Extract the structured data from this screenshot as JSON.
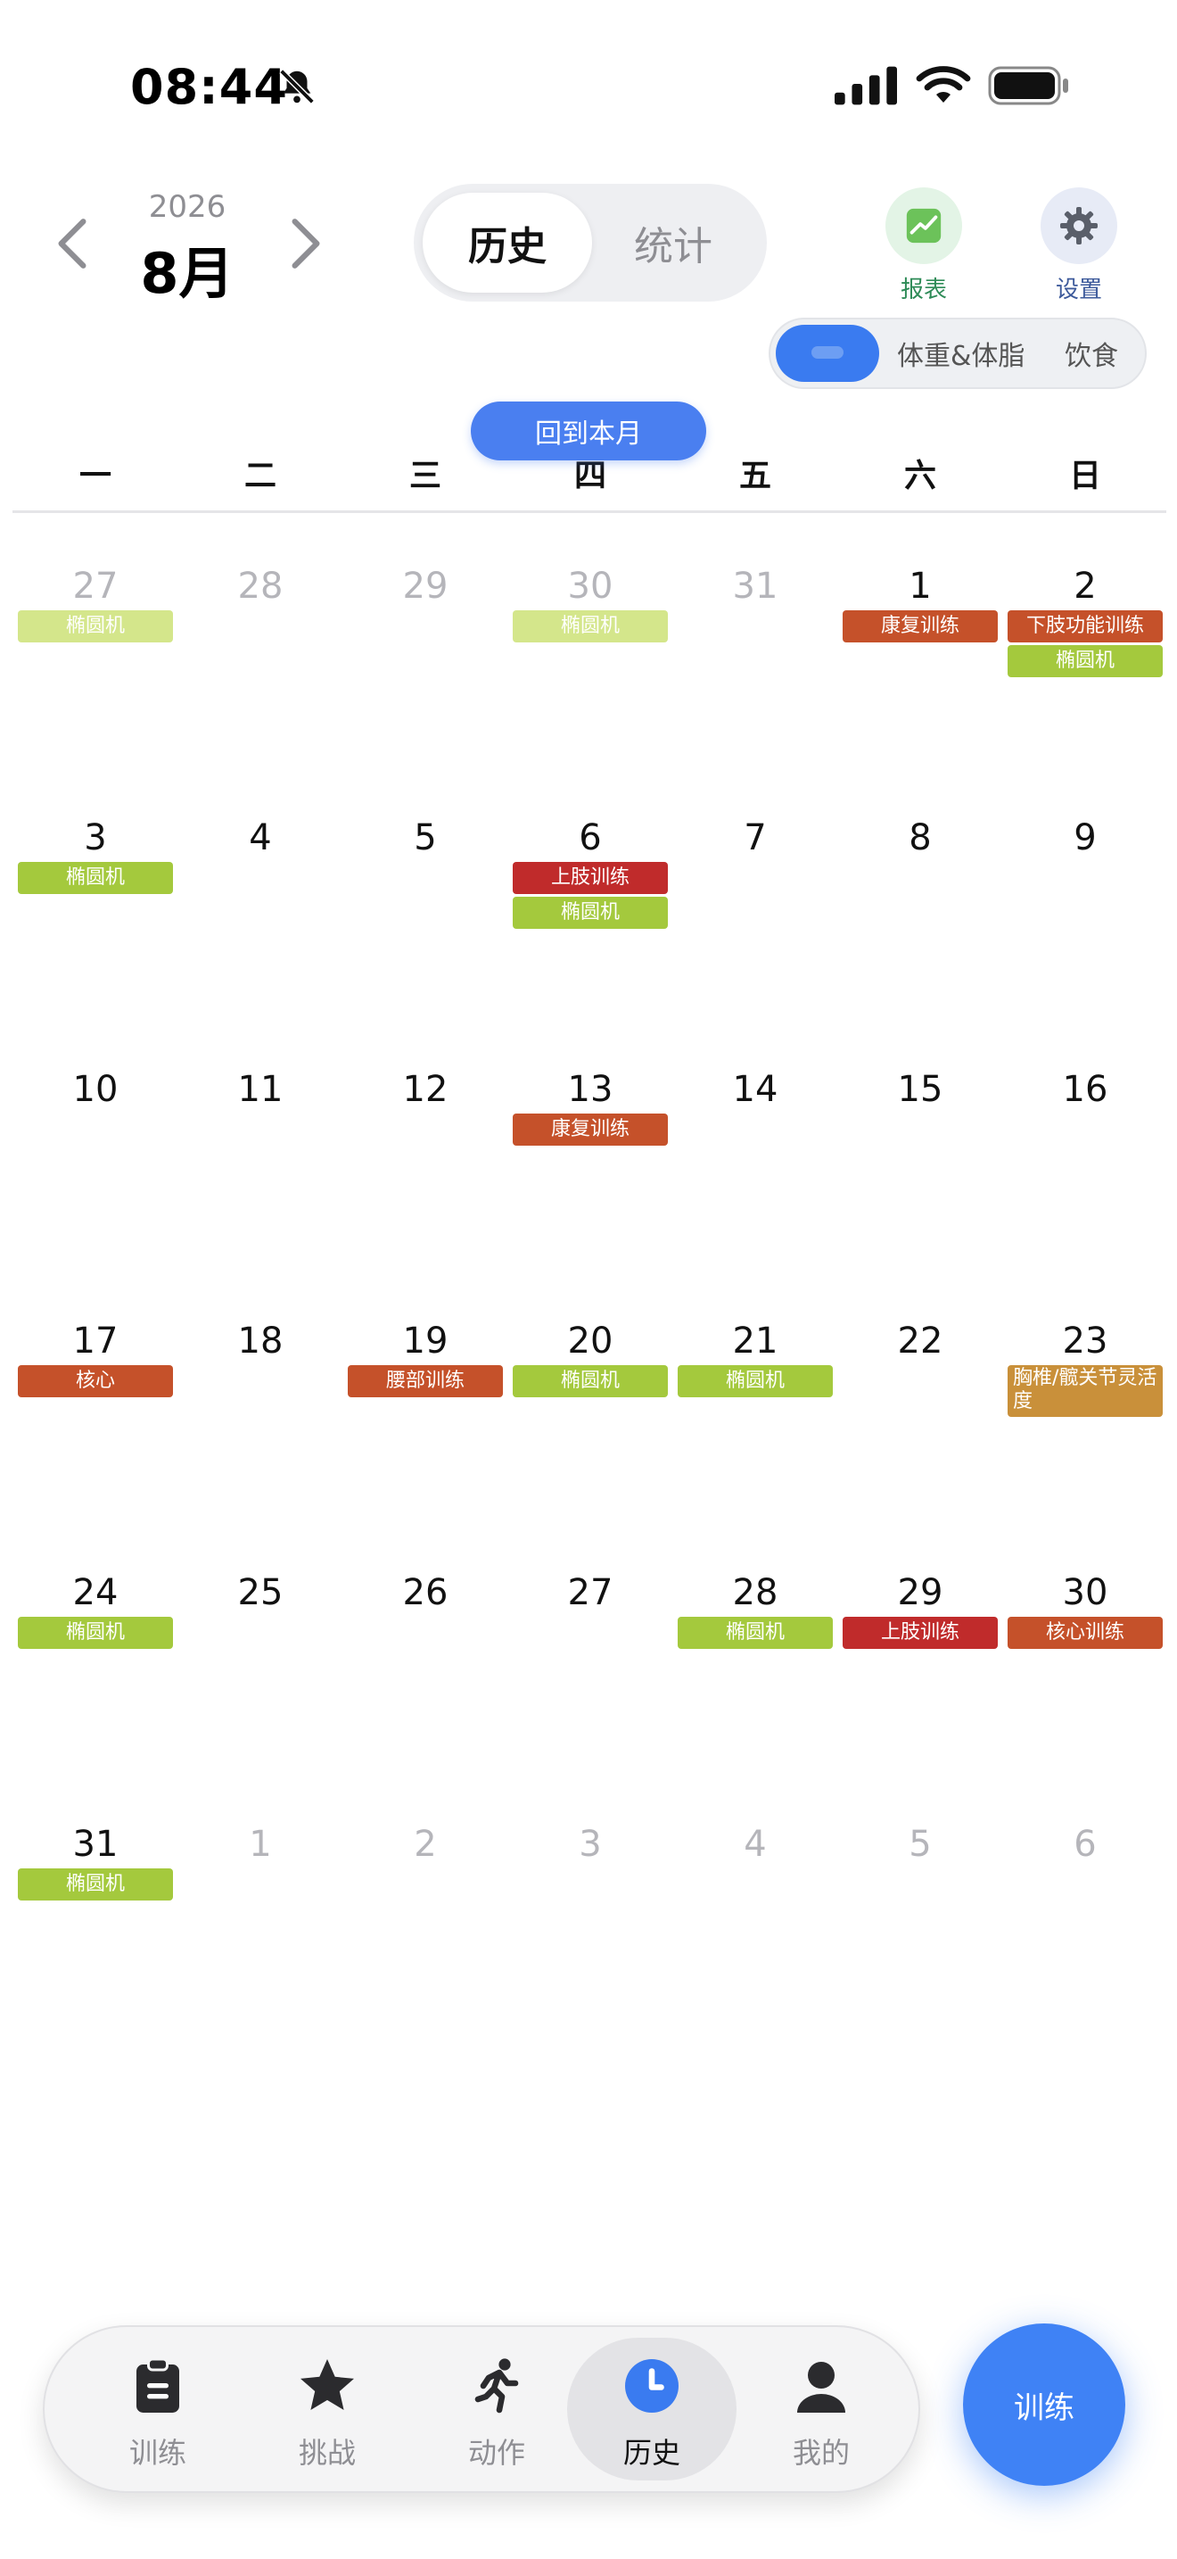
{
  "status_bar": {
    "time": "08:44",
    "icons": [
      "bell-slash-icon",
      "signal-icon",
      "wifi-icon",
      "battery-icon"
    ]
  },
  "header": {
    "year": "2026",
    "month": "8月",
    "segments": [
      "历史",
      "统计"
    ],
    "active_segment": "历史",
    "tools": [
      {
        "label": "报表",
        "icon": "chart-icon"
      },
      {
        "label": "设置",
        "icon": "gear-icon"
      }
    ],
    "filters": [
      "体重&体脂",
      "饮食"
    ],
    "back_to_month": "回到本月"
  },
  "colors": {
    "accent": "#3a7bf0",
    "tag_green": "#a4c93d",
    "tag_green_light": "#d4e68b",
    "tag_orange": "#c5512a",
    "tag_red": "#c02b2b",
    "tag_ochre": "#c9903a"
  },
  "weekdays": [
    "一",
    "二",
    "三",
    "四",
    "五",
    "六",
    "日"
  ],
  "weeks": [
    [
      {
        "day": "27",
        "muted": true,
        "tags": [
          {
            "text": "椭圆机",
            "color": "#d4e68b"
          }
        ]
      },
      {
        "day": "28",
        "muted": true,
        "tags": []
      },
      {
        "day": "29",
        "muted": true,
        "tags": []
      },
      {
        "day": "30",
        "muted": true,
        "tags": [
          {
            "text": "椭圆机",
            "color": "#d4e68b"
          }
        ]
      },
      {
        "day": "31",
        "muted": true,
        "tags": []
      },
      {
        "day": "1",
        "muted": false,
        "tags": [
          {
            "text": "康复训练",
            "color": "#c5512a"
          }
        ]
      },
      {
        "day": "2",
        "muted": false,
        "tags": [
          {
            "text": "下肢功能训练",
            "color": "#c5512a"
          },
          {
            "text": "椭圆机",
            "color": "#a4c93d"
          }
        ]
      }
    ],
    [
      {
        "day": "3",
        "muted": false,
        "tags": [
          {
            "text": "椭圆机",
            "color": "#a4c93d"
          }
        ]
      },
      {
        "day": "4",
        "muted": false,
        "tags": []
      },
      {
        "day": "5",
        "muted": false,
        "tags": []
      },
      {
        "day": "6",
        "muted": false,
        "tags": [
          {
            "text": "上肢训练",
            "color": "#c02b2b"
          },
          {
            "text": "椭圆机",
            "color": "#a4c93d"
          }
        ]
      },
      {
        "day": "7",
        "muted": false,
        "tags": []
      },
      {
        "day": "8",
        "muted": false,
        "tags": []
      },
      {
        "day": "9",
        "muted": false,
        "tags": []
      }
    ],
    [
      {
        "day": "10",
        "muted": false,
        "tags": []
      },
      {
        "day": "11",
        "muted": false,
        "tags": []
      },
      {
        "day": "12",
        "muted": false,
        "tags": []
      },
      {
        "day": "13",
        "muted": false,
        "tags": [
          {
            "text": "康复训练",
            "color": "#c5512a"
          }
        ]
      },
      {
        "day": "14",
        "muted": false,
        "tags": []
      },
      {
        "day": "15",
        "muted": false,
        "tags": []
      },
      {
        "day": "16",
        "muted": false,
        "tags": []
      }
    ],
    [
      {
        "day": "17",
        "muted": false,
        "tags": [
          {
            "text": "核心",
            "color": "#c5512a"
          }
        ]
      },
      {
        "day": "18",
        "muted": false,
        "tags": []
      },
      {
        "day": "19",
        "muted": false,
        "tags": [
          {
            "text": "腰部训练",
            "color": "#c5512a"
          }
        ]
      },
      {
        "day": "20",
        "muted": false,
        "tags": [
          {
            "text": "椭圆机",
            "color": "#a4c93d"
          }
        ]
      },
      {
        "day": "21",
        "muted": false,
        "tags": [
          {
            "text": "椭圆机",
            "color": "#a4c93d"
          }
        ]
      },
      {
        "day": "22",
        "muted": false,
        "tags": []
      },
      {
        "day": "23",
        "muted": false,
        "tags": [
          {
            "text": "胸椎/髋关节灵活度",
            "color": "#c9903a",
            "tall": true
          }
        ]
      }
    ],
    [
      {
        "day": "24",
        "muted": false,
        "tags": [
          {
            "text": "椭圆机",
            "color": "#a4c93d"
          }
        ]
      },
      {
        "day": "25",
        "muted": false,
        "tags": []
      },
      {
        "day": "26",
        "muted": false,
        "tags": []
      },
      {
        "day": "27",
        "muted": false,
        "tags": []
      },
      {
        "day": "28",
        "muted": false,
        "tags": [
          {
            "text": "椭圆机",
            "color": "#a4c93d"
          }
        ]
      },
      {
        "day": "29",
        "muted": false,
        "tags": [
          {
            "text": "上肢训练",
            "color": "#c02b2b"
          }
        ]
      },
      {
        "day": "30",
        "muted": false,
        "tags": [
          {
            "text": "核心训练",
            "color": "#c5512a"
          }
        ]
      }
    ],
    [
      {
        "day": "31",
        "muted": false,
        "tags": [
          {
            "text": "椭圆机",
            "color": "#a4c93d"
          }
        ]
      },
      {
        "day": "1",
        "muted": true,
        "tags": []
      },
      {
        "day": "2",
        "muted": true,
        "tags": []
      },
      {
        "day": "3",
        "muted": true,
        "tags": []
      },
      {
        "day": "4",
        "muted": true,
        "tags": []
      },
      {
        "day": "5",
        "muted": true,
        "tags": []
      },
      {
        "day": "6",
        "muted": true,
        "tags": []
      }
    ]
  ],
  "tabbar": {
    "tabs": [
      {
        "label": "训练",
        "icon": "clipboard-icon"
      },
      {
        "label": "挑战",
        "icon": "star-icon"
      },
      {
        "label": "动作",
        "icon": "running-icon"
      },
      {
        "label": "历史",
        "icon": "clock-icon"
      },
      {
        "label": "我的",
        "icon": "person-icon"
      }
    ],
    "active_tab": "历史",
    "fab_label": "训练"
  }
}
